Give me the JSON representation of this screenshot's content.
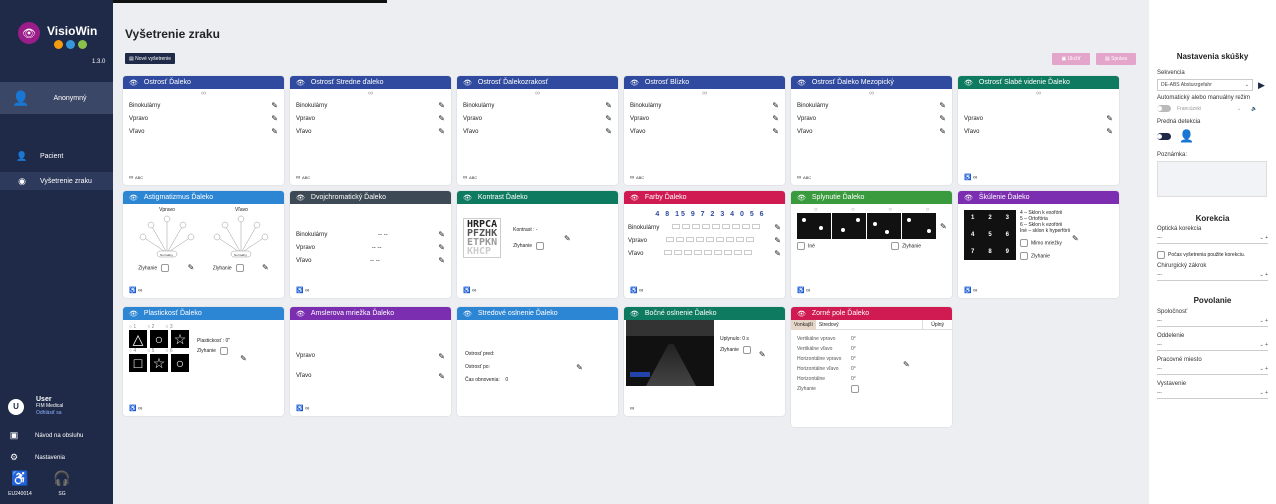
{
  "sidebar": {
    "app_name": "VisioWin",
    "version": "1.3.0",
    "anon": "Anonymný",
    "patient": "Pacient",
    "exam": "Vyšetrenie zraku",
    "user_name": "User",
    "company": "FIM Medical",
    "logout": "Odhlásiť sa",
    "manual": "Návod na obsluhu",
    "settings": "Nastavenia",
    "device1": "EU240014",
    "device2": "SG"
  },
  "header": {
    "title": "Vyšetrenie zraku",
    "new_exam": "Nové vyšetrenie",
    "save": "Uložiť",
    "report": "Správa",
    "icon_glasses": "glasses-icon"
  },
  "cards": {
    "c1": {
      "title": "Ostrosť Ďaleko",
      "r1": "Binokulárny",
      "r2": "Vpravo",
      "r3": "Vľavo",
      "foot": "ABC"
    },
    "c2": {
      "title": "Ostrosť Stredne ďaleko",
      "r1": "Binokulárny",
      "r2": "Vpravo",
      "r3": "Vľavo",
      "foot": "ABC"
    },
    "c3": {
      "title": "Ostrosť Ďalekozrakosť",
      "r1": "Binokulárny",
      "r2": "Vpravo",
      "r3": "Vľavo",
      "foot": "ABC"
    },
    "c4": {
      "title": "Ostrosť Blízko",
      "r1": "Binokulárny",
      "r2": "Vpravo",
      "r3": "Vľavo",
      "foot": "ABC"
    },
    "c5": {
      "title": "Ostrosť Ďaleko Mezopický",
      "r1": "Binokulárny",
      "r2": "Vpravo",
      "r3": "Vľavo",
      "foot": "ABC"
    },
    "c6": {
      "title": "Ostrosť Slabé videnie Ďaleko",
      "r2": "Vpravo",
      "r3": "Vľavo"
    },
    "c7": {
      "title": "Astigmatizmus Ďaleko",
      "right": "Vpravo",
      "left": "Vľavo",
      "fail": "Zlyhanie",
      "normal": "Normálny"
    },
    "c8": {
      "title": "Dvojchromatický Ďaleko",
      "r1": "Binokulárny",
      "r2": "Vpravo",
      "r3": "Vľavo",
      "dash": "--  --"
    },
    "c9": {
      "title": "Kontrast Ďaleko",
      "contrast": "Kontrast : -",
      "fail": "Zlyhanie",
      "l1": "HRPCA",
      "l2": "PFZHK",
      "l3": "ETPKN",
      "l4": "KHCP"
    },
    "c10": {
      "title": "Farby Ďaleko",
      "numbers": "4 8 15 9 7 2 3 4 0 5 6",
      "r1": "Binokulárny",
      "r2": "Vpravo",
      "r3": "Vľavo"
    },
    "c11": {
      "title": "Splynutie Ďaleko",
      "other": "Iné",
      "fail": "Zlyhanie"
    },
    "c12": {
      "title": "Škúlenie Ďaleko",
      "t1": "4 – Sklon k exofórii",
      "t2": "5 – Ortofória",
      "t3": "6 – Sklon k ezofórii",
      "t4": "Iné – sklon k hyperfórii",
      "out": "Mimo mriežky",
      "fail": "Zlyhanie"
    },
    "c13": {
      "title": "Plastickosť Ďaleko",
      "plast": "Plastickosť : 0\"",
      "fail": "Zlyhanie"
    },
    "c14": {
      "title": "Amslerova mriežka Ďaleko",
      "r2": "Vpravo",
      "r3": "Vľavo"
    },
    "c15": {
      "title": "Stredové oslnenie Ďaleko",
      "l1": "Ostrosť pred:",
      "l2": "Ostrosť po:",
      "l3": "Čas obnovenia:",
      "v3": "0"
    },
    "c16": {
      "title": "Bočné oslnenie Ďaleko",
      "elapsed": "Uplynulo: 0 s",
      "fail": "Zlyhanie"
    },
    "c17": {
      "title": "Zorné pole Ďaleko",
      "tab1": "Vonkajší",
      "tab2": "Stredový",
      "tab3": "Úplný",
      "v1": "Vertikálne vpravo",
      "v2": "Vertikálne vľavo",
      "v3": "Horizontálne vpravo",
      "v4": "Horizontálne vľavo",
      "v5": "Horizontálne",
      "v6": "Zlyhanie",
      "deg": "0°"
    }
  },
  "panel": {
    "title": "Nastavenia skúšky",
    "seq_label": "Sekvencia",
    "seq_value": "DE-ABS Absturzgefahr",
    "mode_label": "Automatický alebo manuálny režim",
    "lang": "Francúzski",
    "front_label": "Predná detekcia",
    "note_label": "Poznámka:",
    "corr_title": "Korekcia",
    "opt_label": "Optická korekcia",
    "dash": "---",
    "use_corr": "Počas vyšetrenia použite korekciu.",
    "surg_label": "Chirurgický zákrok",
    "job_title": "Povolanie",
    "company_label": "Spoločnosť",
    "dept_label": "Oddelenie",
    "work_label": "Pracovné miesto",
    "exposure_label": "Vystavenie"
  },
  "colors": {
    "blue": "#2f4a9e",
    "teal": "#0e7a60",
    "lightblue": "#2d86d4",
    "dark": "#3d4a55",
    "red": "#d01b52",
    "purple": "#7b2fb0",
    "green": "#3a9a3e",
    "sidebar": "#1f2a48",
    "accent": "#9b1d8a"
  }
}
